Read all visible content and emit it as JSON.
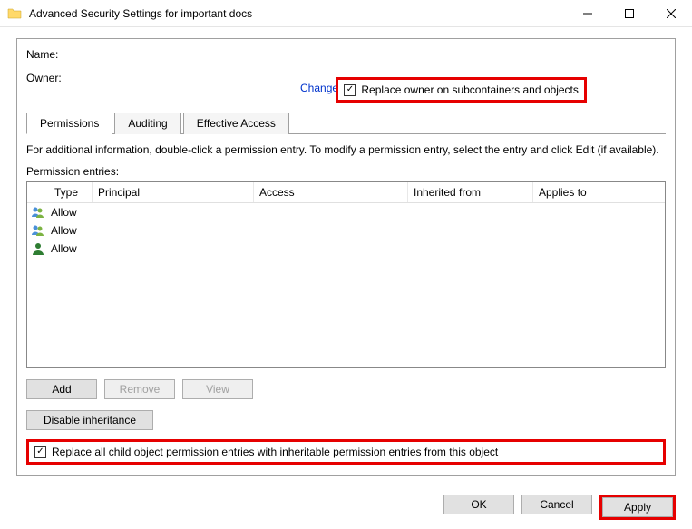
{
  "titlebar": {
    "title": "Advanced Security Settings for important docs"
  },
  "labels": {
    "name": "Name:",
    "owner": "Owner:",
    "change": "Change"
  },
  "replaceOwner": {
    "label": "Replace owner on subcontainers and objects",
    "checked": true
  },
  "tabs": {
    "permissions": "Permissions",
    "auditing": "Auditing",
    "effective": "Effective Access"
  },
  "infoText": "For additional information, double-click a permission entry. To modify a permission entry, select the entry and click Edit (if available).",
  "permEntriesLabel": "Permission entries:",
  "columns": {
    "type": "Type",
    "principal": "Principal",
    "access": "Access",
    "inherited": "Inherited from",
    "applies": "Applies to"
  },
  "entries": [
    {
      "type": "Allow",
      "icon": "group"
    },
    {
      "type": "Allow",
      "icon": "group"
    },
    {
      "type": "Allow",
      "icon": "user"
    }
  ],
  "buttons": {
    "add": "Add",
    "remove": "Remove",
    "view": "View",
    "disableInheritance": "Disable inheritance",
    "ok": "OK",
    "cancel": "Cancel",
    "apply": "Apply"
  },
  "replaceChild": {
    "label": "Replace all child object permission entries with inheritable permission entries from this object",
    "checked": true
  }
}
